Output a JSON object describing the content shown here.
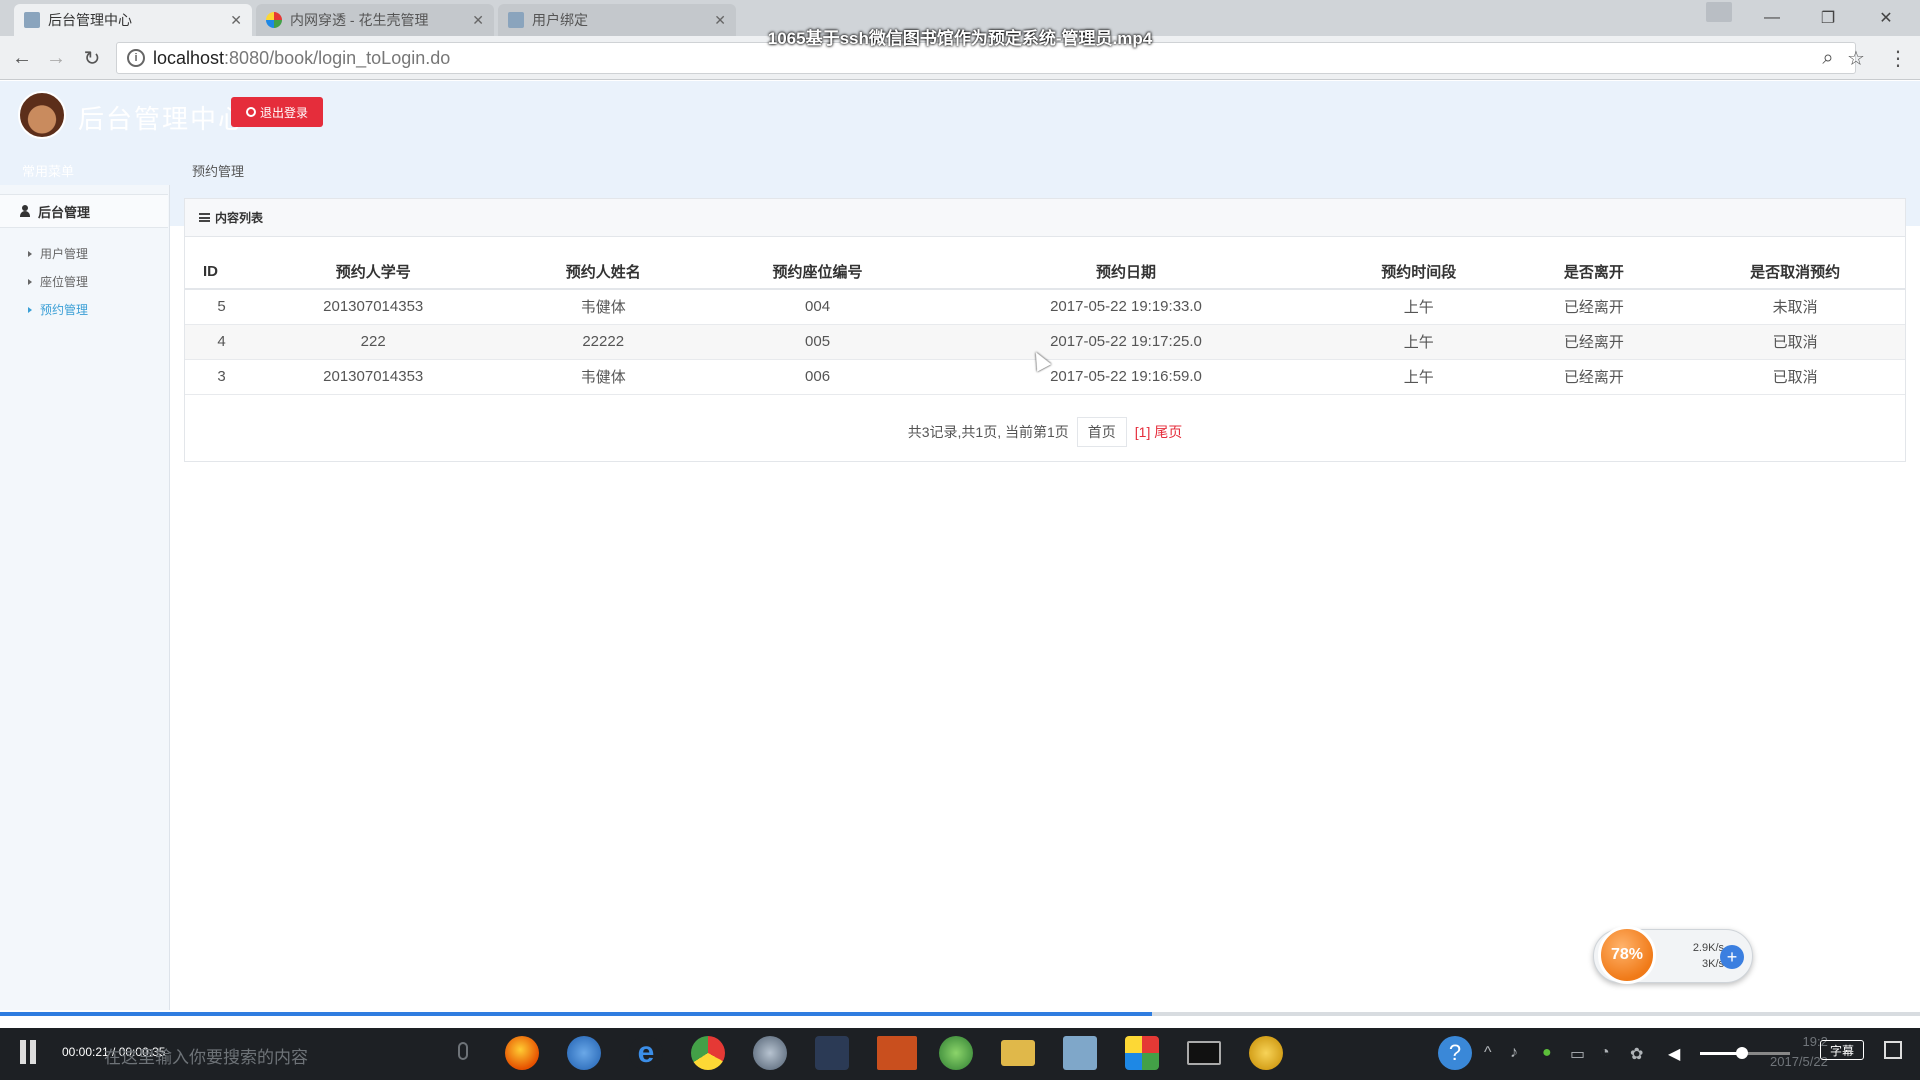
{
  "browser": {
    "tabs": [
      {
        "title": "后台管理中心",
        "active": true
      },
      {
        "title": "内网穿透 - 花生壳管理",
        "active": false
      },
      {
        "title": "用户绑定",
        "active": false
      }
    ],
    "video_title": "1065基于ssh微信图书馆作为预定系统-管理员.mp4",
    "url_host": "localhost",
    "url_path": ":8080/book/login_toLogin.do"
  },
  "header": {
    "app_title": "后台管理中心",
    "logout_label": "退出登录",
    "sidebar_head_label": "常用菜单",
    "breadcrumb": "预约管理"
  },
  "sidebar": {
    "section_label": "后台管理",
    "items": [
      {
        "label": "用户管理",
        "active": false
      },
      {
        "label": "座位管理",
        "active": false
      },
      {
        "label": "预约管理",
        "active": true
      }
    ]
  },
  "panel": {
    "title": "内容列表",
    "columns": [
      "ID",
      "预约人学号",
      "预约人姓名",
      "预约座位编号",
      "预约日期",
      "预约时间段",
      "是否离开",
      "是否取消预约"
    ],
    "rows": [
      [
        "5",
        "201307014353",
        "韦健体",
        "004",
        "2017-05-22 19:19:33.0",
        "上午",
        "已经离开",
        "未取消"
      ],
      [
        "4",
        "222",
        "22222",
        "005",
        "2017-05-22 19:17:25.0",
        "上午",
        "已经离开",
        "已取消"
      ],
      [
        "3",
        "201307014353",
        "韦健体",
        "006",
        "2017-05-22 19:16:59.0",
        "上午",
        "已经离开",
        "已取消"
      ]
    ],
    "pager": {
      "summary": "共3记录,共1页, 当前第1页",
      "first_label": "首页",
      "page_label": "[1]",
      "last_label": "尾页"
    }
  },
  "widget": {
    "percent": "78%",
    "up_rate": "2.9K/s",
    "down_rate": "3K/s"
  },
  "player": {
    "time": "00:00:21 / 00:00:35",
    "progress_fraction": 0.6
  },
  "taskbar": {
    "search_placeholder": "在这里输入你要搜索的内容",
    "clock_time": "19:2",
    "clock_date": "2017/5/22",
    "subtitle_label": "字幕"
  },
  "colors": {
    "accent_red": "#e52d3b",
    "active_link": "#3a9fd6",
    "header_bg": "#eaf2fb"
  }
}
